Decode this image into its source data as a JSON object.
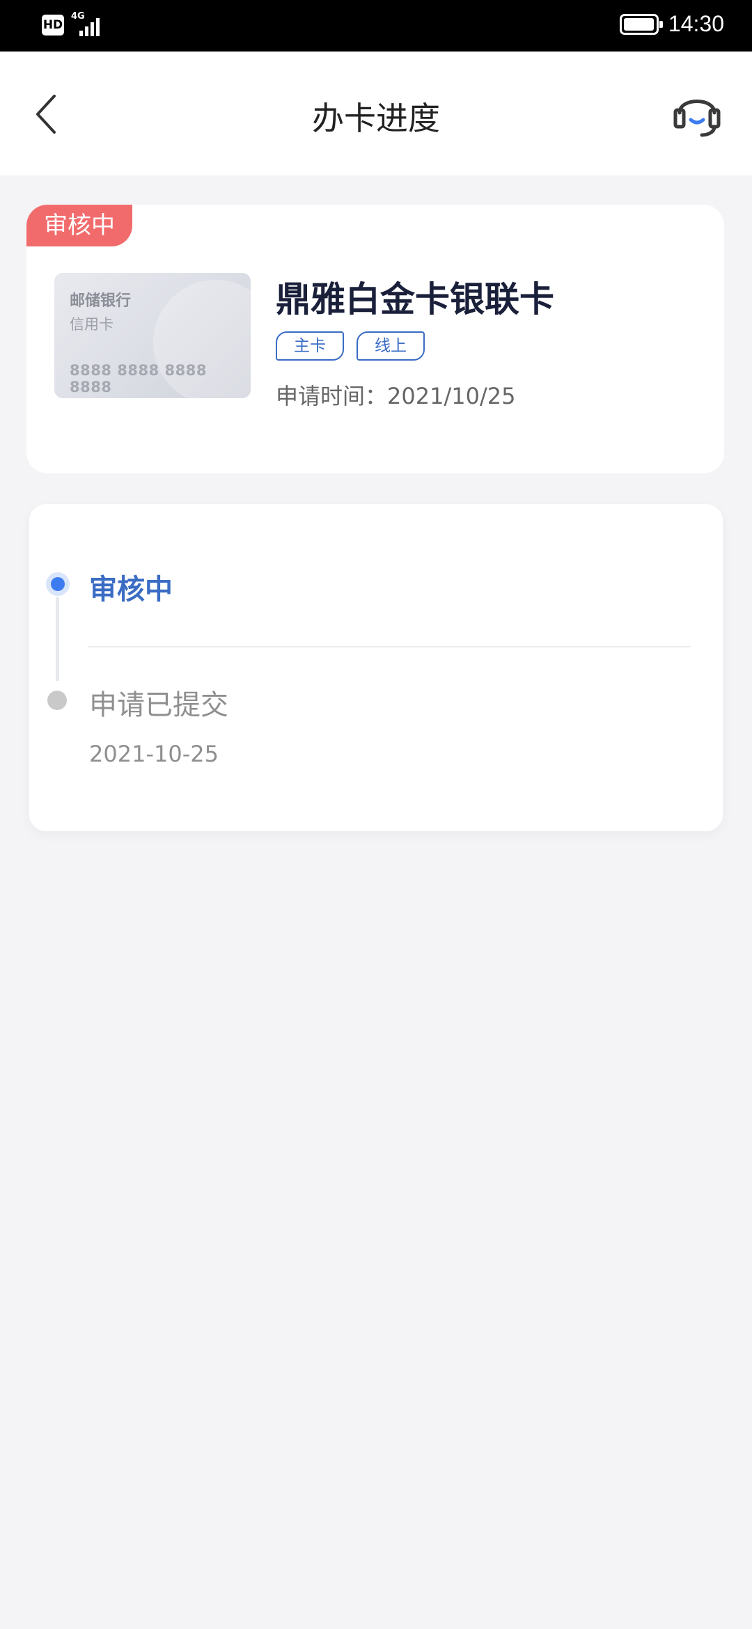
{
  "status_bar": {
    "hd": "HD",
    "network": "4G",
    "time": "14:30"
  },
  "header": {
    "title": "办卡进度"
  },
  "card": {
    "status_tag": "审核中",
    "image_bank": "邮储银行",
    "image_kind": "信用卡",
    "image_number": "8888 8888 8888 8888",
    "name": "鼎雅白金卡银联卡",
    "tags": [
      "主卡",
      "线上"
    ],
    "apply_time": "申请时间：2021/10/25"
  },
  "timeline": {
    "current_step": "审核中",
    "previous_step": "申请已提交",
    "previous_date": "2021-10-25"
  },
  "colors": {
    "accent": "#3a6cc4",
    "status_tag": "#f26b6c"
  }
}
